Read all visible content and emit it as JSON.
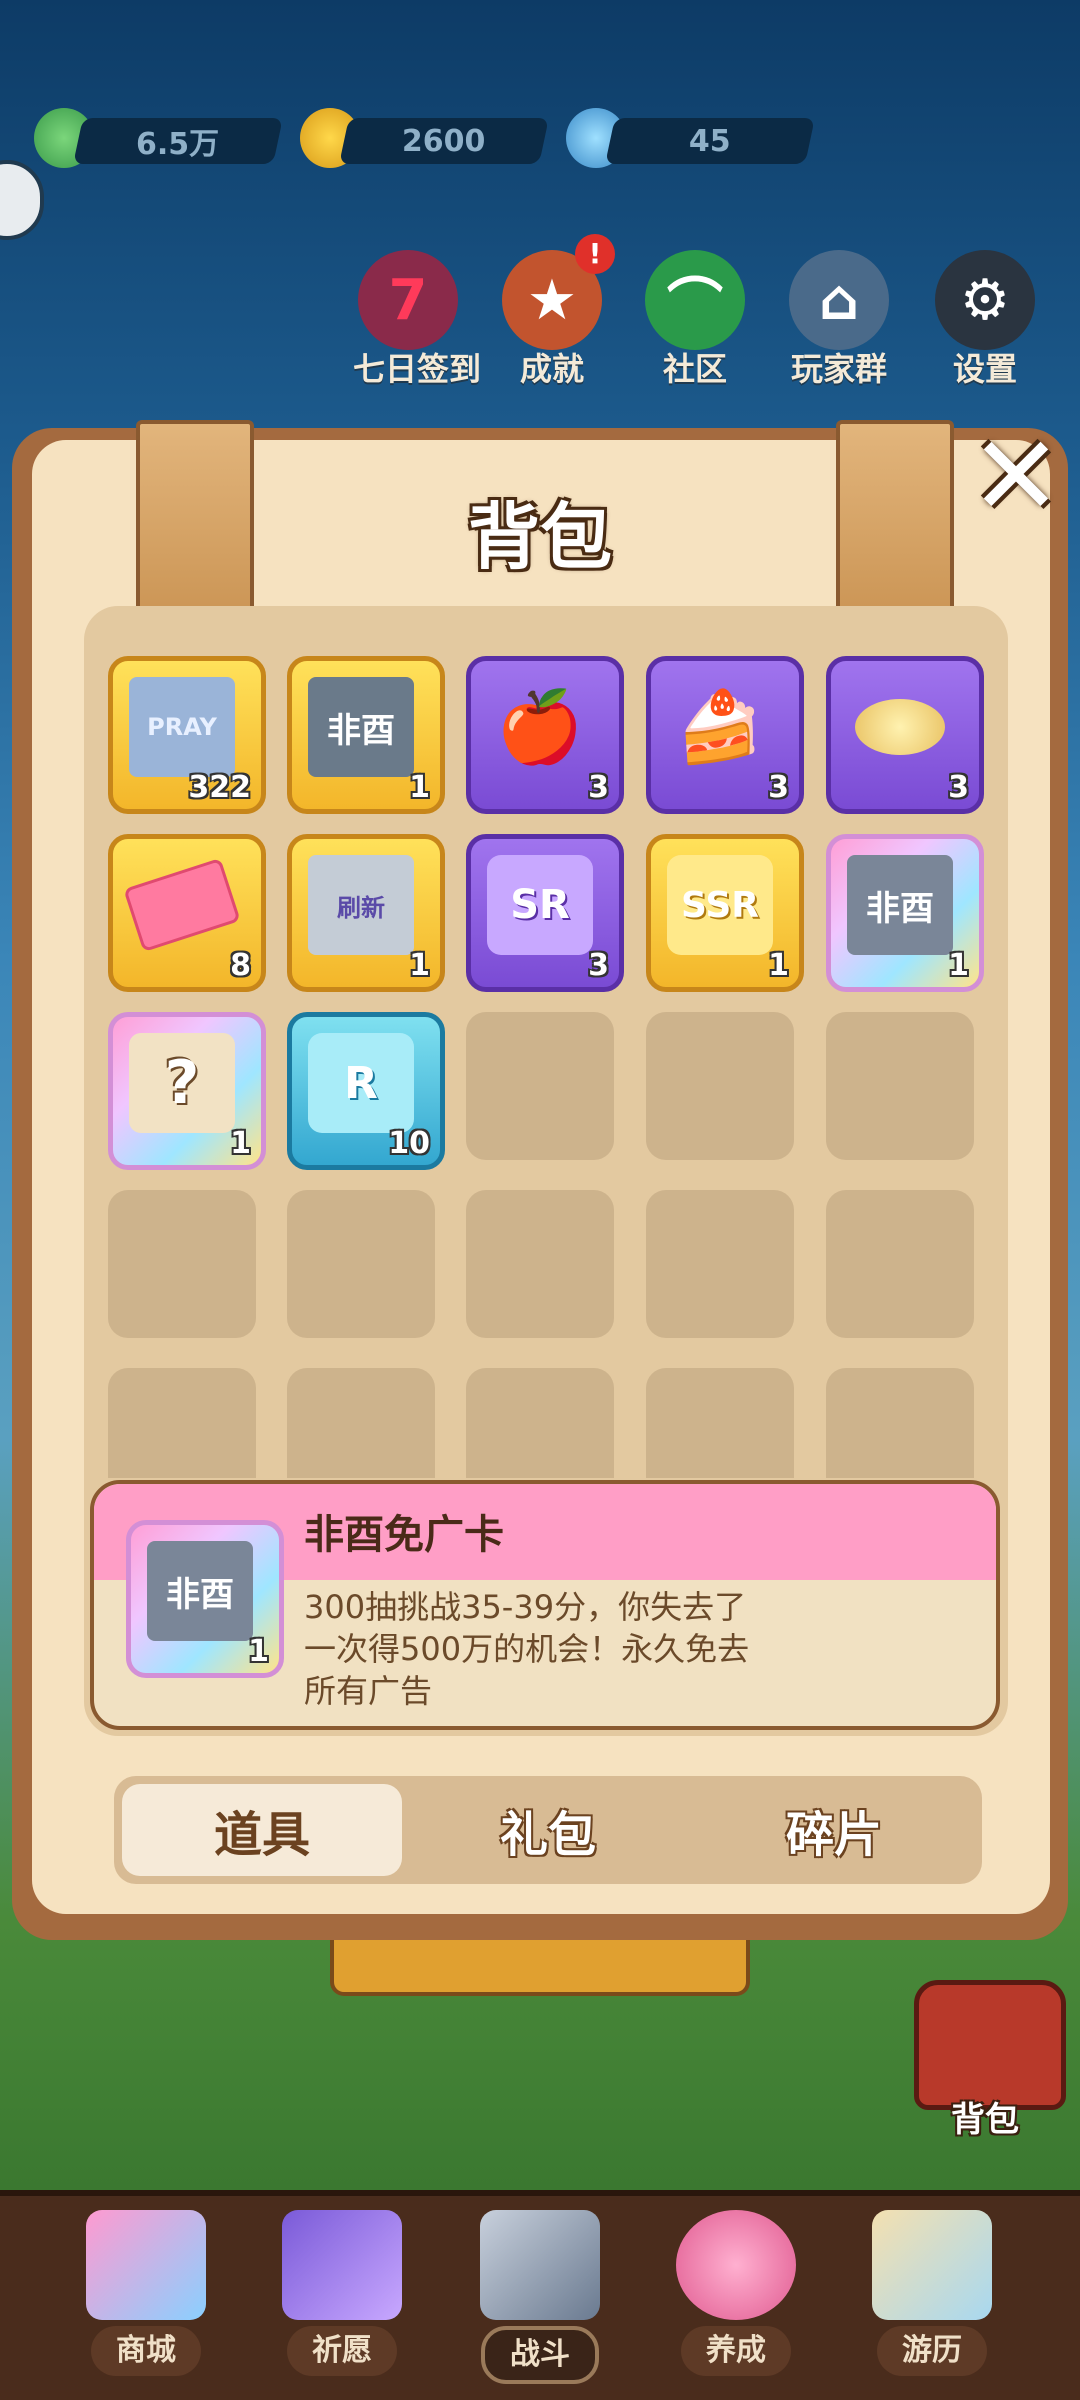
{
  "top_bar": {
    "gems": "6.5万",
    "coins": "2600",
    "energy": "45"
  },
  "top_menu": [
    {
      "label": "七日签到",
      "glyph": "7"
    },
    {
      "label": "成就",
      "glyph": "★",
      "badge": "!"
    },
    {
      "label": "社区",
      "glyph": "⌒"
    },
    {
      "label": "玩家群",
      "glyph": "⌂"
    },
    {
      "label": "设置",
      "glyph": "⚙"
    }
  ],
  "panel": {
    "title": "背包",
    "close_glyph": "✕"
  },
  "items": [
    {
      "name": "pray-ticket",
      "text": "PRAY",
      "count": "322",
      "rarity": "gold"
    },
    {
      "name": "fei-you-fragment",
      "text": "非酉",
      "count": "1",
      "rarity": "gold"
    },
    {
      "name": "apple",
      "text": "🍎",
      "count": "3",
      "rarity": "purple"
    },
    {
      "name": "cake",
      "text": "🍰",
      "count": "3",
      "rarity": "purple"
    },
    {
      "name": "chips",
      "text": "",
      "count": "3",
      "rarity": "purple"
    },
    {
      "name": "pink-ticket",
      "text": "",
      "count": "8",
      "rarity": "gold"
    },
    {
      "name": "refresh-card",
      "text": "刷新",
      "count": "1",
      "rarity": "gold"
    },
    {
      "name": "sr-puzzle",
      "text": "SR",
      "count": "3",
      "rarity": "purple"
    },
    {
      "name": "ssr-puzzle",
      "text": "SSR",
      "count": "1",
      "rarity": "gold"
    },
    {
      "name": "fei-you-card",
      "text": "非酉",
      "count": "1",
      "rarity": "rainbow"
    },
    {
      "name": "mystery-bag",
      "text": "?",
      "count": "1",
      "rarity": "rainbow"
    },
    {
      "name": "r-puzzle",
      "text": "R",
      "count": "10",
      "rarity": "blue"
    }
  ],
  "detail": {
    "name": "非酉免广卡",
    "description": "300抽挑战35-39分，你失去了一次得500万的机会！永久免去所有广告",
    "count": "1",
    "icon_text": "非酉"
  },
  "tabs": [
    {
      "label": "道具",
      "active": true
    },
    {
      "label": "礼包",
      "active": false
    },
    {
      "label": "碎片",
      "active": false
    }
  ],
  "bag_label": "背包",
  "bottom_nav": [
    {
      "label": "商城"
    },
    {
      "label": "祈愿"
    },
    {
      "label": "战斗",
      "active": true
    },
    {
      "label": "养成"
    },
    {
      "label": "游历"
    }
  ]
}
